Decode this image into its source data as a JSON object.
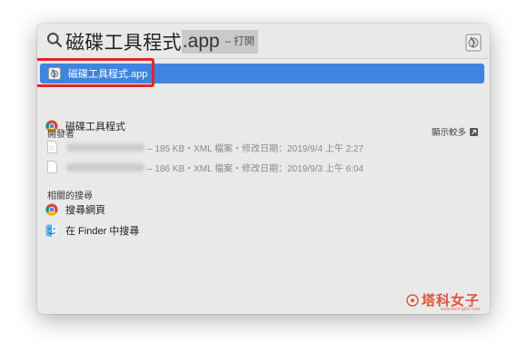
{
  "search": {
    "typed": "磁碟工具程式",
    "completion": ".app",
    "action": "– 打開"
  },
  "results": {
    "top_hit": {
      "label": "磁碟工具程式.app",
      "icon": "disk-utility-icon"
    },
    "second": {
      "label": "磁碟工具程式",
      "icon": "chrome-icon"
    }
  },
  "developer": {
    "header": "開發者",
    "show_more": "顯示較多",
    "files": [
      {
        "meta": "– 185 KB・XML 檔案・修改日期：2019/9/4 上午 2:27"
      },
      {
        "meta": "– 186 KB・XML 檔案・修改日期：2019/9/3 上午 6:04"
      }
    ]
  },
  "related": {
    "header": "相關的搜尋",
    "items": [
      {
        "label": "搜尋網頁",
        "icon": "chrome-icon"
      },
      {
        "label": "在 Finder 中搜尋",
        "icon": "finder-icon"
      }
    ]
  },
  "watermark": {
    "text": "塔科女子",
    "sub": "www.tech-girlz.com"
  },
  "colors": {
    "selection": "#3f84de",
    "highlight_border": "#e5232b",
    "watermark": "#e0553a",
    "panel": "#e9e9ea"
  }
}
